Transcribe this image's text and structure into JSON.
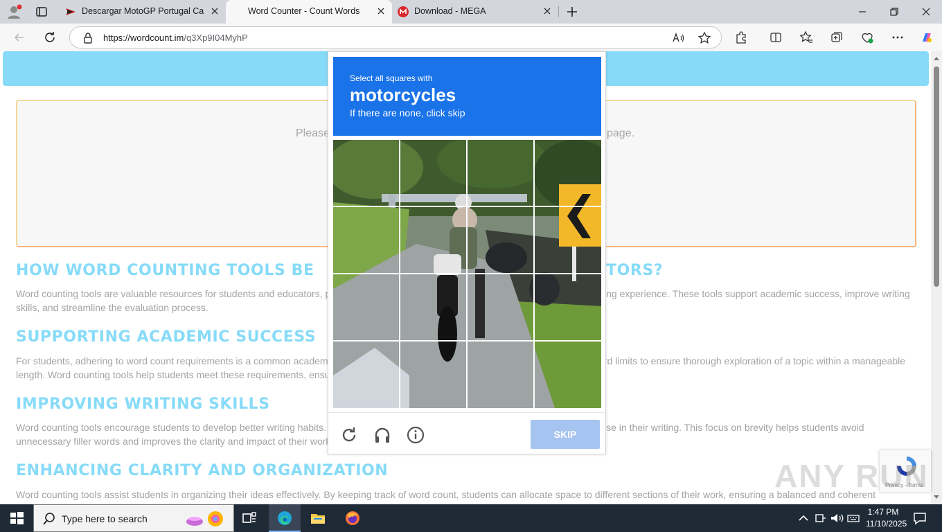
{
  "browser": {
    "tabs": [
      {
        "label": "Descargar MotoGP Portugal Carre",
        "icon": "motogp-favicon",
        "active": false
      },
      {
        "label": "Word Counter - Count Words",
        "icon": "none",
        "active": true
      },
      {
        "label": "Download - MEGA",
        "icon": "mega-favicon",
        "active": false
      }
    ],
    "url_host": "https://wordcount.im",
    "url_path": "/q3Xp9I04MyhP"
  },
  "page": {
    "placeholder_left": "Please",
    "placeholder_right": "page.",
    "sections": [
      {
        "heading": "HOW WORD COUNTING TOOLS BE",
        "heading_tail": "TORS?",
        "lines": [
          "Word counting tools are valuable resources for students and educators, p",
          "ing experience. These tools support academic success, improve writing",
          "skills, and streamline the evaluation process."
        ]
      },
      {
        "heading": "SUPPORTING ACADEMIC SUCCESS",
        "heading_tail": "",
        "lines": [
          "For students, adhering to word count requirements is a common academ",
          "rd limits to ensure thorough exploration of a topic within a manageable",
          "length. Word counting tools help students meet these requirements, ensu"
        ]
      },
      {
        "heading": "IMPROVING WRITING SKILLS",
        "heading_tail": "",
        "lines": [
          "Word counting tools encourage students to develop better writing habits.",
          "ise in their writing. This focus on brevity helps students avoid",
          "unnecessary filler words and improves the clarity and impact of their work"
        ]
      },
      {
        "heading": "ENHANCING CLARITY AND ORGANIZATION",
        "heading_tail": "",
        "lines": [
          "Word counting tools assist students in organizing their ideas effectively. By keeping track of word count, students can allocate space to different sections of their work, ensuring a balanced and coherent"
        ]
      }
    ]
  },
  "captcha": {
    "instruction_small": "Select all squares with",
    "target": "motorcycles",
    "instruction_hint": "If there are none, click skip",
    "skip_label": "SKIP",
    "grid_rows": 4,
    "grid_cols": 4
  },
  "recaptcha_badge": {
    "terms": "Privacy - Terms"
  },
  "watermark": "ANY RUN",
  "taskbar": {
    "search_placeholder": "Type here to search",
    "time": "1:47 PM",
    "date": "11/10/2025"
  }
}
